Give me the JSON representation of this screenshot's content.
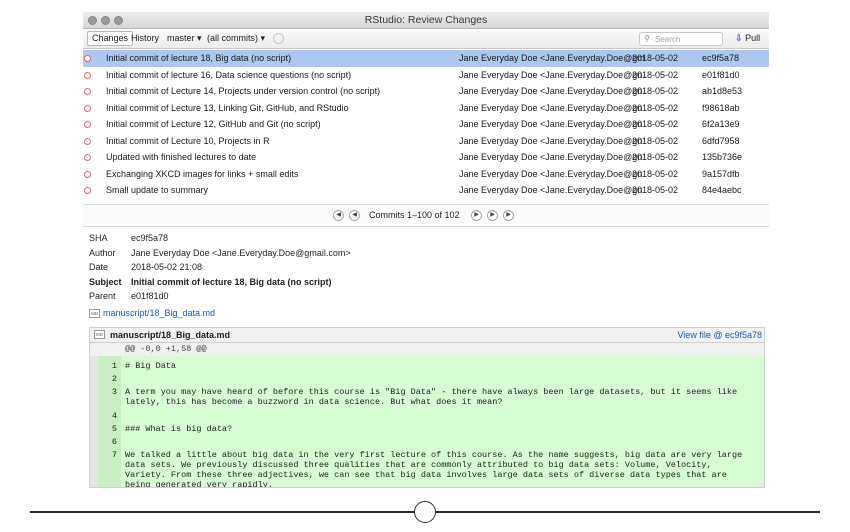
{
  "window": {
    "title": "RStudio: Review Changes"
  },
  "toolbar": {
    "changes_tab": "Changes",
    "history_tab": "History",
    "branch": "master",
    "branch_caret": "▾",
    "commits_filter": "(all commits)",
    "commits_caret": "▾",
    "search_placeholder": "Search",
    "pull_label": "Pull"
  },
  "commits": [
    {
      "subject": "Initial commit of lecture 18, Big data (no script)",
      "author": "Jane Everyday Doe <Jane.Everyday.Doe@gm",
      "date": "2018-05-02",
      "sha": "ec9f5a78",
      "selected": true
    },
    {
      "subject": "Initial commit of lecture 16, Data science questions (no script)",
      "author": "Jane Everyday Doe <Jane.Everyday.Doe@gn",
      "date": "2018-05-02",
      "sha": "e01f81d0"
    },
    {
      "subject": "Initial commit of Lecture 14, Projects under version control (no script)",
      "author": "Jane Everyday Doe <Jane.Everyday.Doe@gn",
      "date": "2018-05-02",
      "sha": "ab1d8e53"
    },
    {
      "subject": "Initial commit of Lecture 13, Linking Git, GitHub, and RStudio",
      "author": "Jane Everyday Doe <Jane.Everyday.Doe@gn",
      "date": "2018-05-02",
      "sha": "f98618ab"
    },
    {
      "subject": "Initial commit of Lecture 12, GitHub and Git (no script)",
      "author": "Jane Everyday Doe <Jane.Everyday.Doe@gn",
      "date": "2018-05-02",
      "sha": "6f2a13e9"
    },
    {
      "subject": "Initial commit of Lecture 10, Projects in R",
      "author": "Jane Everyday Doe <Jane.Everyday.Doe@gn",
      "date": "2018-05-02",
      "sha": "6dfd7958"
    },
    {
      "subject": "Updated with finished lectures to date",
      "author": "Jane Everyday Doe <Jane.Everyday.Doe@gn",
      "date": "2018-05-02",
      "sha": "135b736e"
    },
    {
      "subject": "Exchanging XKCD images for links + small edits",
      "author": "Jane Everyday Doe <Jane.Everyday.Doe@gn",
      "date": "2018-05-02",
      "sha": "9a157dfb"
    },
    {
      "subject": "Small update to summary",
      "author": "Jane Everyday Doe <Jane.Everyday.Doe@gn",
      "date": "2018-05-02",
      "sha": "84e4aebc"
    }
  ],
  "pager": {
    "text": "Commits 1–100 of 102"
  },
  "details": {
    "sha_label": "SHA",
    "sha": "ec9f5a78",
    "author_label": "Author",
    "author": "Jane Everyday Doe <Jane.Everyday.Doe@gmail.com>",
    "date_label": "Date",
    "date": "2018-05-02 21:08",
    "subject_label": "Subject",
    "subject": "Initial commit of lecture 18, Big data (no script)",
    "parent_label": "Parent",
    "parent": "e01f81d0",
    "file_link": "manuscript/18_Big_data.md"
  },
  "diff": {
    "file_icon": "MD",
    "file": "manuscript/18_Big_data.md",
    "view_file": "View file @ ec9f5a78",
    "hunk": "@@ -0,0 +1,58 @@",
    "lines": [
      {
        "n": "1",
        "text": "# Big Data"
      },
      {
        "n": "2",
        "text": ""
      },
      {
        "n": "3",
        "text": "A term you may have heard of before this course is \"Big Data\" - there have always been large datasets, but it seems like lately, this has become a buzzword in data science. But what does it mean?"
      },
      {
        "n": "4",
        "text": ""
      },
      {
        "n": "5",
        "text": "### What is big data?"
      },
      {
        "n": "6",
        "text": ""
      },
      {
        "n": "7",
        "text": "We talked a little about big data in the very first lecture of this course. As the name suggests, big data are very large data sets. We previously discussed three qualities that are commonly attributed to big data sets: Volume, Velocity, Variety. From these three adjectives, we can see that big data involves large data sets of diverse data types that are being generated very rapidly."
      }
    ]
  },
  "colors": {
    "selected_row": "#adc8ee",
    "graph": "#d46a70",
    "diff_added": "#d7fbd3",
    "link": "#1e57a8"
  }
}
